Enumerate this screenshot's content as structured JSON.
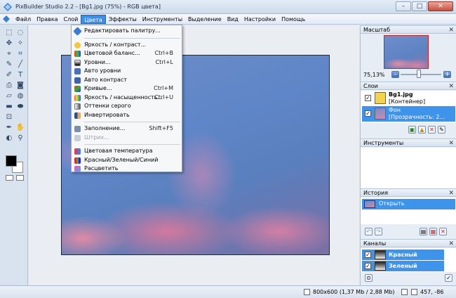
{
  "window": {
    "title": "PixBuilder Studio 2.2 - [Bg1.jpg (75%) - RGB цвета]",
    "minimize": "–",
    "maximize": "□",
    "close": "✕"
  },
  "menubar": {
    "items": [
      "Файл",
      "Правка",
      "Слой",
      "Цвета",
      "Эффекты",
      "Инструменты",
      "Выделение",
      "Вид",
      "Настройки",
      "Помощь"
    ]
  },
  "color_menu": {
    "edit_palette": "Редактировать палитру...",
    "brightness": "Яркость / контраст...",
    "color_balance": "Цветовой баланс...",
    "color_balance_sc": "Ctrl+B",
    "levels": "Уровни...",
    "levels_sc": "Ctrl+L",
    "auto_levels": "Авто уровни",
    "auto_contrast": "Авто контраст",
    "curves": "Кривые...",
    "curves_sc": "Ctrl+M",
    "hue_sat": "Яркость / насыщенность...",
    "hue_sat_sc": "Ctrl+U",
    "grayscale": "Оттенки серого",
    "invert": "Инвертировать",
    "fill": "Заполнение...",
    "fill_sc": "Shift+F5",
    "stroke": "Штрих...",
    "color_temp": "Цветовая температура",
    "rgb": "Красный/Зеленый/Синий",
    "colorize": "Расцветить"
  },
  "panels": {
    "navigator": {
      "title": "Масштаб",
      "zoom": "75,13%",
      "zoom_minus": "–",
      "zoom_plus": "+"
    },
    "layers": {
      "title": "Слои",
      "rows": [
        {
          "name": "Bg1.jpg",
          "sub": "[Контейнер]"
        },
        {
          "name": "Фон",
          "sub": "[Прозрачность: 2..."
        }
      ]
    },
    "tools": {
      "title": "Инструменты"
    },
    "history": {
      "title": "История",
      "item": "Открыть"
    },
    "channels": {
      "title": "Каналы",
      "items": [
        "Красный",
        "Зеленый"
      ]
    },
    "close_x": "✕"
  },
  "statusbar": {
    "image_info": "800x600  (1,37 Mb / 2,88 Mb)",
    "coords": "457, -86"
  },
  "colors": {
    "menu_active": "#3c8ee6",
    "selection": "#3d94ea"
  }
}
